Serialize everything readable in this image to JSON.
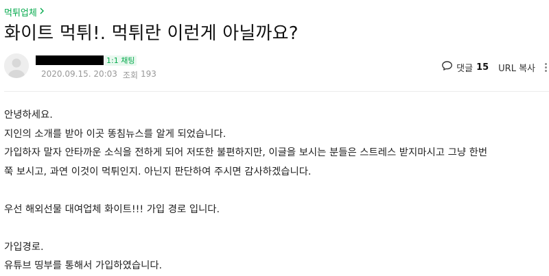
{
  "breadcrumb": {
    "label": "먹튀업체",
    "chevron_icon": "chevron-right-icon"
  },
  "title": "화이트 먹튀!. 먹튀란 이런게 아닐까요?",
  "author": {
    "name": "████████████",
    "chat_label": "1:1 채팅",
    "date": "2020.09.15. 20:03",
    "views_label": "조회",
    "views": "193",
    "avatar_icon": "default-avatar-icon"
  },
  "actions": {
    "comment_label": "댓글",
    "comment_count": "15",
    "url_copy_label": "URL 복사",
    "more_icon": "vertical-ellipsis-icon"
  },
  "content": {
    "lines": [
      "안녕하세요.",
      "지인의 소개를 받아 이곳 똥침뉴스를 알게 되었습니다.",
      "가입하자 말자 안타까운 소식을 전하게 되어 저또한 불편하지만, 이글을 보시는 분들은 스트레스 받지마시고 그냥 한번",
      "쭉 보시고, 과연 이것이 먹튀인지. 아닌지 판단하여 주시면 감사하겠습니다.",
      "",
      "우선 해외선물 대여업체 화이트!!! 가입 경로 입니다.",
      "",
      "가입경로.",
      "유튜브 띵부를 통해서 가입하였습니다."
    ]
  },
  "colors": {
    "accent": "#03a94b",
    "meta": "#979797",
    "text": "#222222"
  }
}
